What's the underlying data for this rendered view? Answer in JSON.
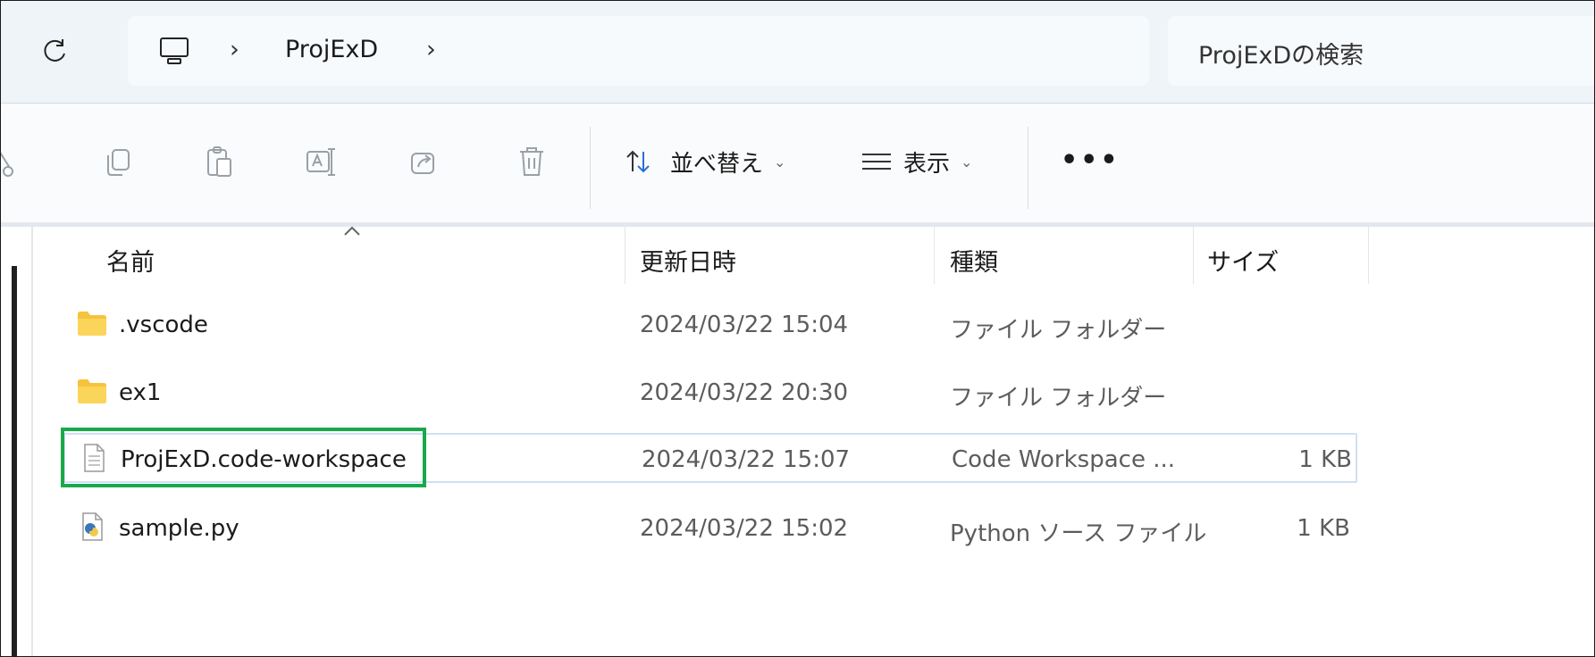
{
  "address_bar": {
    "breadcrumb_folder": "ProjExD",
    "search_placeholder": "ProjExDの検索"
  },
  "command_bar": {
    "sort_label": "並べ替え",
    "view_label": "表示"
  },
  "columns": {
    "name": "名前",
    "modified": "更新日時",
    "type": "種類",
    "size": "サイズ"
  },
  "files": [
    {
      "name": ".vscode",
      "modified": "2024/03/22 15:04",
      "type": "ファイル フォルダー",
      "size": "",
      "icon": "folder-icon"
    },
    {
      "name": "ex1",
      "modified": "2024/03/22 20:30",
      "type": "ファイル フォルダー",
      "size": "",
      "icon": "folder-icon"
    },
    {
      "name": "ProjExD.code-workspace",
      "modified": "2024/03/22 15:07",
      "type": "Code Workspace ...",
      "size": "1 KB",
      "icon": "document-icon"
    },
    {
      "name": "sample.py",
      "modified": "2024/03/22 15:02",
      "type": "Python ソース ファイル",
      "size": "1 KB",
      "icon": "python-file-icon"
    }
  ],
  "colors": {
    "highlight_border": "#19a84a",
    "selection_border": "#cfe1f3",
    "folder_yellow": "#f6c33c"
  }
}
